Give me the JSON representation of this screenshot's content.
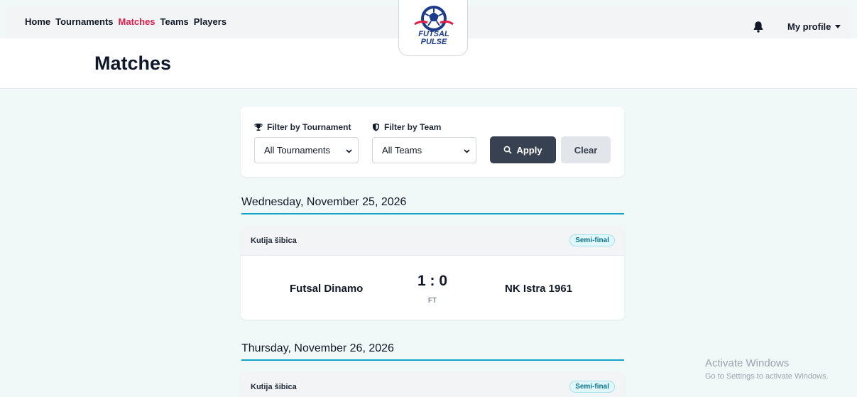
{
  "nav": {
    "items": [
      {
        "label": "Home",
        "active": false
      },
      {
        "label": "Tournaments",
        "active": false
      },
      {
        "label": "Matches",
        "active": true
      },
      {
        "label": "Teams",
        "active": false
      },
      {
        "label": "Players",
        "active": false
      }
    ],
    "active_color": "#e11d48"
  },
  "logo": {
    "line1": "FUTSAL",
    "line2": "PULSE",
    "icon": "futsal-ball-logo"
  },
  "header_right": {
    "notification_icon": "bell-icon",
    "profile_label": "My profile"
  },
  "page": {
    "title": "Matches"
  },
  "filters": {
    "tournament_label": "Filter by Tournament",
    "tournament_icon": "trophy-icon",
    "tournament_value": "All Tournaments",
    "team_label": "Filter by Team",
    "team_icon": "shield-icon",
    "team_value": "All Teams",
    "apply_label": "Apply",
    "apply_icon": "search-icon",
    "clear_label": "Clear"
  },
  "days": [
    {
      "date": "Wednesday, November 25, 2026",
      "matches": [
        {
          "tournament": "Kutija šibica",
          "stage": "Semi-final",
          "home": "Futsal Dinamo",
          "score": "1 : 0",
          "status": "FT",
          "away": "NK Istra 1961"
        }
      ]
    },
    {
      "date": "Thursday, November 26, 2026",
      "matches": [
        {
          "tournament": "Kutija šibica",
          "stage": "Semi-final"
        }
      ]
    }
  ],
  "watermark": {
    "title": "Activate Windows",
    "subtitle": "Go to Settings to activate Windows."
  },
  "colors": {
    "accent": "#0ea5c6",
    "apply_button": "#374151",
    "background": "#f1f9f8"
  }
}
